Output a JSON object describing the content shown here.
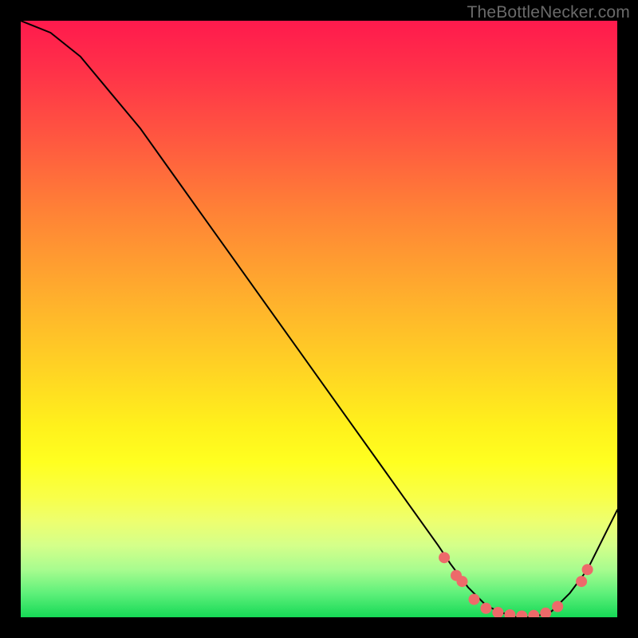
{
  "watermark": "TheBottleNecker.com",
  "colors": {
    "frame": "#000000",
    "curve": "#000000",
    "dot": "#ed6a6a"
  },
  "chart_data": {
    "type": "line",
    "title": "",
    "xlabel": "",
    "ylabel": "",
    "xlim": [
      0,
      100
    ],
    "ylim": [
      0,
      100
    ],
    "x": [
      0,
      5,
      10,
      15,
      20,
      25,
      30,
      35,
      40,
      45,
      50,
      55,
      60,
      65,
      70,
      72,
      75,
      78,
      80,
      83,
      86,
      89,
      92,
      95,
      98,
      100
    ],
    "values": [
      100,
      98,
      94,
      88,
      82,
      75,
      68,
      61,
      54,
      47,
      40,
      33,
      26,
      19,
      12,
      9,
      5,
      2,
      1,
      0,
      0,
      1,
      4,
      8,
      14,
      18
    ],
    "highlight_points": [
      {
        "x": 71,
        "y": 10
      },
      {
        "x": 73,
        "y": 7
      },
      {
        "x": 74,
        "y": 6
      },
      {
        "x": 76,
        "y": 3
      },
      {
        "x": 78,
        "y": 1.5
      },
      {
        "x": 80,
        "y": 0.8
      },
      {
        "x": 82,
        "y": 0.4
      },
      {
        "x": 84,
        "y": 0.2
      },
      {
        "x": 86,
        "y": 0.3
      },
      {
        "x": 88,
        "y": 0.7
      },
      {
        "x": 90,
        "y": 1.8
      },
      {
        "x": 94,
        "y": 6
      },
      {
        "x": 95,
        "y": 8
      }
    ]
  }
}
